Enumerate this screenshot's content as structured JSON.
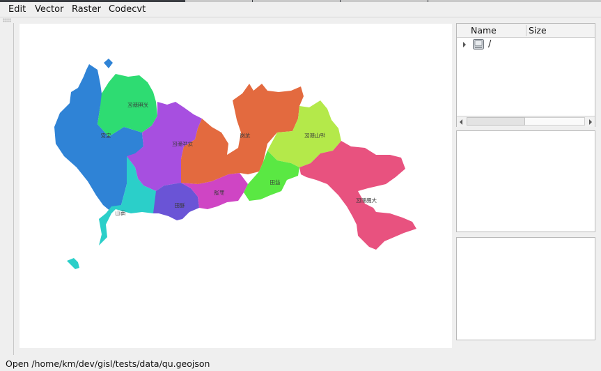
{
  "menubar": {
    "items": [
      {
        "label": "Edit"
      },
      {
        "label": "Vector"
      },
      {
        "label": "Raster"
      },
      {
        "label": "Codecvt"
      }
    ]
  },
  "file_tree": {
    "columns": [
      "Name",
      "Size"
    ],
    "rows": [
      {
        "icon": "drive-icon",
        "label": "/"
      }
    ]
  },
  "map": {
    "layer_file": "qu.geojson",
    "regions": [
      {
        "id": "baoan",
        "label": "宝安",
        "color": "#2f83d6"
      },
      {
        "id": "guangming",
        "label": "光明新区",
        "color": "#2edc72"
      },
      {
        "id": "longhua",
        "label": "龙华新区",
        "color": "#a74fe0"
      },
      {
        "id": "nanshan",
        "label": "南山",
        "color": "#2bcfc9"
      },
      {
        "id": "futian",
        "label": "福田",
        "color": "#6a54d6"
      },
      {
        "id": "luohu",
        "label": "罗湖",
        "color": "#cf45c4"
      },
      {
        "id": "longgang",
        "label": "龙岗",
        "color": "#e36a3f"
      },
      {
        "id": "pingshan",
        "label": "坪山新区",
        "color": "#b4e94a"
      },
      {
        "id": "yantian",
        "label": "盐田",
        "color": "#5ae843"
      },
      {
        "id": "dapeng",
        "label": "大鹏新区",
        "color": "#e8527f"
      }
    ]
  },
  "statusbar": {
    "text": "Open /home/km/dev/gisl/tests/data/qu.geojson"
  }
}
